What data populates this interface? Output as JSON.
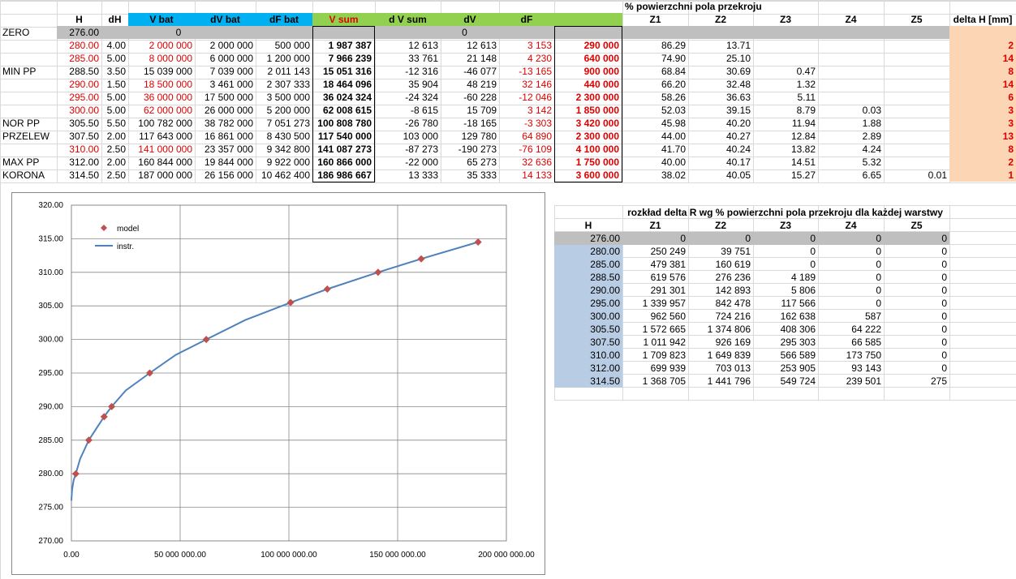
{
  "main_table": {
    "headers": [
      "H",
      "dH",
      "V bat",
      "dV bat",
      "dF bat",
      "V sum",
      "d V sum",
      "dV",
      "dF"
    ],
    "section_title": "% powierzchni pola przekroju",
    "z_headers": [
      "Z1",
      "Z2",
      "Z3",
      "Z4",
      "Z5"
    ],
    "delta_header": "delta H [mm]",
    "zero_row": {
      "label": "ZERO",
      "H": "276.00",
      "vbat": "0",
      "vsum": "0"
    },
    "rows": [
      {
        "label": "",
        "H": "280.00",
        "dH": "4.00",
        "vbat": "2 000 000",
        "dvbat": "2 000 000",
        "dfbat": "500 000",
        "vsum": "1 987 387",
        "dvsum": "12 613",
        "dv": "12 613",
        "df": "3 153",
        "box": "290 000",
        "z": [
          "86.29",
          "13.71",
          "",
          "",
          ""
        ],
        "delta": "2",
        "red": true
      },
      {
        "label": "",
        "H": "285.00",
        "dH": "5.00",
        "vbat": "8 000 000",
        "dvbat": "6 000 000",
        "dfbat": "1 200 000",
        "vsum": "7 966 239",
        "dvsum": "33 761",
        "dv": "21 148",
        "df": "4 230",
        "box": "640 000",
        "z": [
          "74.90",
          "25.10",
          "",
          "",
          ""
        ],
        "delta": "14",
        "red": true
      },
      {
        "label": "MIN PP",
        "H": "288.50",
        "dH": "3.50",
        "vbat": "15 039 000",
        "dvbat": "7 039 000",
        "dfbat": "2 011 143",
        "vsum": "15 051 316",
        "dvsum": "-12 316",
        "dv": "-46 077",
        "df": "-13 165",
        "box": "900 000",
        "z": [
          "68.84",
          "30.69",
          "0.47",
          "",
          ""
        ],
        "delta": "8",
        "red": false
      },
      {
        "label": "",
        "H": "290.00",
        "dH": "1.50",
        "vbat": "18 500 000",
        "dvbat": "3 461 000",
        "dfbat": "2 307 333",
        "vsum": "18 464 096",
        "dvsum": "35 904",
        "dv": "48 219",
        "df": "32 146",
        "box": "440 000",
        "z": [
          "66.20",
          "32.48",
          "1.32",
          "",
          ""
        ],
        "delta": "14",
        "red": true
      },
      {
        "label": "",
        "H": "295.00",
        "dH": "5.00",
        "vbat": "36 000 000",
        "dvbat": "17 500 000",
        "dfbat": "3 500 000",
        "vsum": "36 024 324",
        "dvsum": "-24 324",
        "dv": "-60 228",
        "df": "-12 046",
        "box": "2 300 000",
        "z": [
          "58.26",
          "36.63",
          "5.11",
          "",
          ""
        ],
        "delta": "6",
        "red": true
      },
      {
        "label": "",
        "H": "300.00",
        "dH": "5.00",
        "vbat": "62 000 000",
        "dvbat": "26 000 000",
        "dfbat": "5 200 000",
        "vsum": "62 008 615",
        "dvsum": "-8 615",
        "dv": "15 709",
        "df": "3 142",
        "box": "1 850 000",
        "z": [
          "52.03",
          "39.15",
          "8.79",
          "0.03",
          ""
        ],
        "delta": "3",
        "red": true
      },
      {
        "label": "NOR PP",
        "H": "305.50",
        "dH": "5.50",
        "vbat": "100 782 000",
        "dvbat": "38 782 000",
        "dfbat": "7 051 273",
        "vsum": "100 808 780",
        "dvsum": "-26 780",
        "dv": "-18 165",
        "df": "-3 303",
        "box": "3 420 000",
        "z": [
          "45.98",
          "40.20",
          "11.94",
          "1.88",
          ""
        ],
        "delta": "3",
        "red": false
      },
      {
        "label": "PRZELEW",
        "H": "307.50",
        "dH": "2.00",
        "vbat": "117 643 000",
        "dvbat": "16 861 000",
        "dfbat": "8 430 500",
        "vsum": "117 540 000",
        "dvsum": "103 000",
        "dv": "129 780",
        "df": "64 890",
        "box": "2 300 000",
        "z": [
          "44.00",
          "40.27",
          "12.84",
          "2.89",
          ""
        ],
        "delta": "13",
        "red": false
      },
      {
        "label": "",
        "H": "310.00",
        "dH": "2.50",
        "vbat": "141 000 000",
        "dvbat": "23 357 000",
        "dfbat": "9 342 800",
        "vsum": "141 087 273",
        "dvsum": "-87 273",
        "dv": "-190 273",
        "df": "-76 109",
        "box": "4 100 000",
        "z": [
          "41.70",
          "40.24",
          "13.82",
          "4.24",
          ""
        ],
        "delta": "8",
        "red": true
      },
      {
        "label": "MAX PP",
        "H": "312.00",
        "dH": "2.00",
        "vbat": "160 844 000",
        "dvbat": "19 844 000",
        "dfbat": "9 922 000",
        "vsum": "160 866 000",
        "dvsum": "-22 000",
        "dv": "65 273",
        "df": "32 636",
        "box": "1 750 000",
        "z": [
          "40.00",
          "40.17",
          "14.51",
          "5.32",
          ""
        ],
        "delta": "2",
        "red": false
      },
      {
        "label": "KORONA",
        "H": "314.50",
        "dH": "2.50",
        "vbat": "187 000 000",
        "dvbat": "26 156 000",
        "dfbat": "10 462 400",
        "vsum": "186 986 667",
        "dvsum": "13 333",
        "dv": "35 333",
        "df": "14 133",
        "box": "3 600 000",
        "z": [
          "38.02",
          "40.05",
          "15.27",
          "6.65",
          "0.01"
        ],
        "delta": "1",
        "red": false
      }
    ]
  },
  "dist_table": {
    "title": "rozkład delta R wg % powierzchni pola przekroju dla każdej warstwy",
    "headers": [
      "H",
      "Z1",
      "Z2",
      "Z3",
      "Z4",
      "Z5"
    ],
    "rows": [
      [
        "276.00",
        "0",
        "0",
        "0",
        "0",
        "0"
      ],
      [
        "280.00",
        "250 249",
        "39 751",
        "0",
        "0",
        "0"
      ],
      [
        "285.00",
        "479 381",
        "160 619",
        "0",
        "0",
        "0"
      ],
      [
        "288.50",
        "619 576",
        "276 236",
        "4 189",
        "0",
        "0"
      ],
      [
        "290.00",
        "291 301",
        "142 893",
        "5 806",
        "0",
        "0"
      ],
      [
        "295.00",
        "1 339 957",
        "842 478",
        "117 566",
        "0",
        "0"
      ],
      [
        "300.00",
        "962 560",
        "724 216",
        "162 638",
        "587",
        "0"
      ],
      [
        "305.50",
        "1 572 665",
        "1 374 806",
        "408 306",
        "64 222",
        "0"
      ],
      [
        "307.50",
        "1 011 942",
        "926 169",
        "295 303",
        "66 585",
        "0"
      ],
      [
        "310.00",
        "1 709 823",
        "1 649 839",
        "566 589",
        "173 750",
        "0"
      ],
      [
        "312.00",
        "699 939",
        "703 013",
        "253 905",
        "93 143",
        "0"
      ],
      [
        "314.50",
        "1 368 705",
        "1 441 796",
        "549 724",
        "239 501",
        "275"
      ]
    ]
  },
  "chart_data": {
    "type": "scatter",
    "title": "",
    "xlabel": "",
    "ylabel": "",
    "xlim": [
      0,
      200000000
    ],
    "ylim": [
      270,
      320
    ],
    "x_ticks": [
      "0.00",
      "50 000 000.00",
      "100 000 000.00",
      "150 000 000.00",
      "200 000 000.00"
    ],
    "y_ticks": [
      "270.00",
      "275.00",
      "280.00",
      "285.00",
      "290.00",
      "295.00",
      "300.00",
      "305.00",
      "310.00",
      "315.00",
      "320.00"
    ],
    "legend": {
      "position": "top-left",
      "entries": [
        "model",
        "instr."
      ]
    },
    "series": [
      {
        "name": "model",
        "marker": "diamond",
        "color": "#c0504d",
        "x": [
          2000000,
          8000000,
          15039000,
          18500000,
          36000000,
          62000000,
          100782000,
          117643000,
          141000000,
          160844000,
          187000000
        ],
        "y": [
          280.0,
          285.0,
          288.5,
          290.0,
          295.0,
          300.0,
          305.5,
          307.5,
          310.0,
          312.0,
          314.5
        ]
      },
      {
        "name": "instr.",
        "line": true,
        "color": "#4f81bd",
        "x": [
          0,
          300000,
          1000000,
          2000000,
          4000000,
          8000000,
          12000000,
          15039000,
          18500000,
          25000000,
          36000000,
          48000000,
          62000000,
          80000000,
          100782000,
          117643000,
          141000000,
          160844000,
          187000000
        ],
        "y": [
          276.0,
          277.6,
          279.0,
          280.0,
          282.2,
          285.0,
          287.0,
          288.5,
          290.0,
          292.4,
          295.0,
          297.7,
          300.0,
          302.9,
          305.5,
          307.5,
          310.0,
          312.0,
          314.5
        ]
      }
    ],
    "grid": true
  },
  "colors": {
    "header_green": "#92d050",
    "header_blue": "#00b0f0",
    "red_text": "#e00000",
    "gray_fill": "#bfbfbf",
    "peach_fill": "#fcd5b4",
    "blue_fill": "#b8cce4"
  }
}
